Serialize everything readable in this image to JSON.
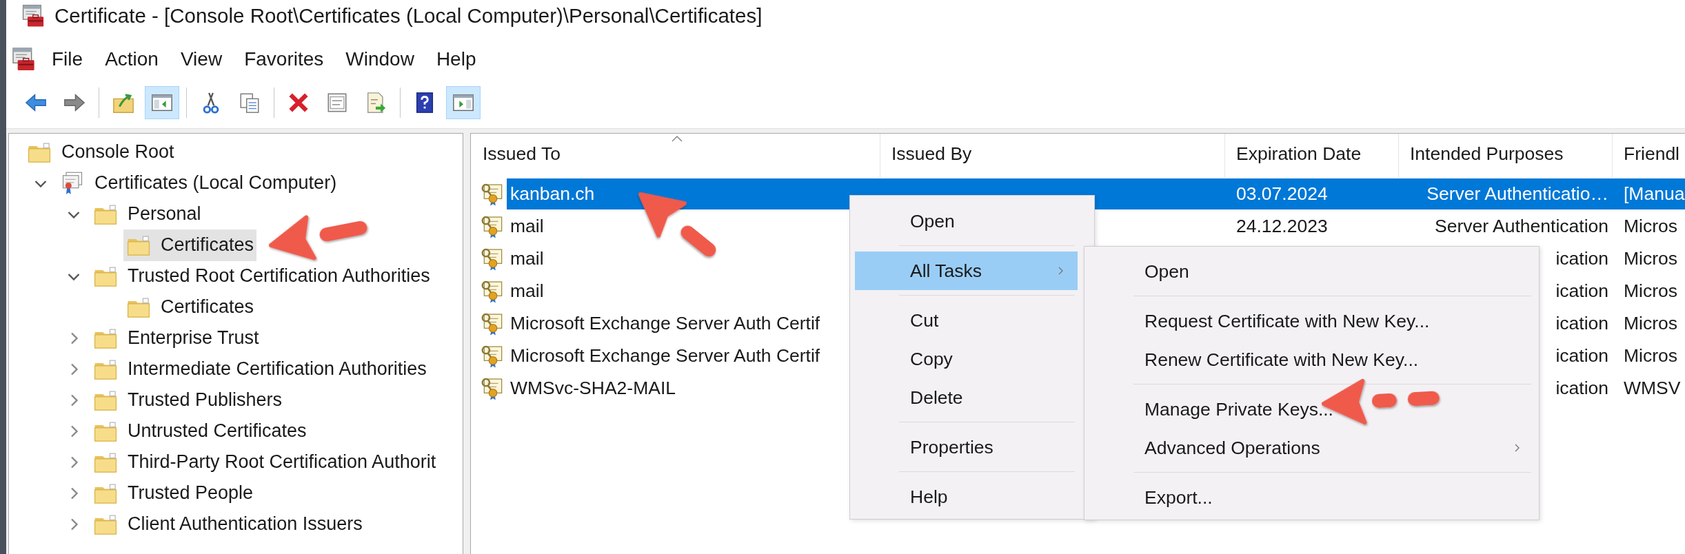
{
  "window": {
    "title": "Certificate - [Console Root\\Certificates (Local Computer)\\Personal\\Certificates]"
  },
  "menu": [
    "File",
    "Action",
    "View",
    "Favorites",
    "Window",
    "Help"
  ],
  "toolbar": [
    [
      {
        "kind": "back",
        "on": false
      },
      {
        "kind": "forward",
        "on": false
      }
    ],
    [
      {
        "kind": "up",
        "on": false
      },
      {
        "kind": "console-tree",
        "on": true
      }
    ],
    [
      {
        "kind": "cut",
        "on": false
      },
      {
        "kind": "copy",
        "on": false
      }
    ],
    [
      {
        "kind": "delete",
        "on": false
      },
      {
        "kind": "properties",
        "on": false
      },
      {
        "kind": "export",
        "on": false
      }
    ],
    [
      {
        "kind": "help",
        "on": false
      },
      {
        "kind": "action-pane",
        "on": true
      }
    ]
  ],
  "tree": [
    {
      "label": "Console Root",
      "kind": "folder",
      "selected": false,
      "children": [
        {
          "label": "Certificates (Local Computer)",
          "kind": "snapin",
          "expanded": true,
          "selected": false,
          "children": [
            {
              "label": "Personal",
              "kind": "folder",
              "expanded": true,
              "selected": false,
              "children": [
                {
                  "label": "Certificates",
                  "kind": "folder",
                  "selected": true
                }
              ]
            },
            {
              "label": "Trusted Root Certification Authorities",
              "kind": "folder",
              "expanded": true,
              "selected": false,
              "children": [
                {
                  "label": "Certificates",
                  "kind": "folder",
                  "selected": false
                }
              ]
            },
            {
              "label": "Enterprise Trust",
              "kind": "folder",
              "expanded": false,
              "selected": false
            },
            {
              "label": "Intermediate Certification Authorities",
              "kind": "folder",
              "expanded": false,
              "selected": false
            },
            {
              "label": "Trusted Publishers",
              "kind": "folder",
              "expanded": false,
              "selected": false
            },
            {
              "label": "Untrusted Certificates",
              "kind": "folder",
              "expanded": false,
              "selected": false
            },
            {
              "label": "Third-Party Root Certification Authorit",
              "kind": "folder",
              "expanded": false,
              "selected": false
            },
            {
              "label": "Trusted People",
              "kind": "folder",
              "expanded": false,
              "selected": false
            },
            {
              "label": "Client Authentication Issuers",
              "kind": "folder",
              "expanded": false,
              "selected": false
            }
          ]
        }
      ]
    }
  ],
  "list": {
    "columns": [
      {
        "label": "Issued To",
        "sorted": true
      },
      {
        "label": "Issued By",
        "sorted": false
      },
      {
        "label": "Expiration Date",
        "sorted": false
      },
      {
        "label": "Intended Purposes",
        "sorted": false
      },
      {
        "label": "Friendl",
        "sorted": false
      }
    ],
    "rows": [
      {
        "selected": true,
        "cells": [
          "kanban.ch",
          null,
          "03.07.2024",
          "Server Authenticatio…",
          "[Manua"
        ]
      },
      {
        "selected": false,
        "cells": [
          "mail",
          null,
          "24.12.2023",
          "Server Authentication",
          "Micros"
        ]
      },
      {
        "selected": false,
        "cells": [
          "mail",
          null,
          null,
          "ication",
          "Micros"
        ]
      },
      {
        "selected": false,
        "cells": [
          "mail",
          null,
          null,
          "ication",
          "Micros"
        ]
      },
      {
        "selected": false,
        "cells": [
          "Microsoft Exchange Server Auth Certif",
          null,
          null,
          "ication",
          "Micros"
        ]
      },
      {
        "selected": false,
        "cells": [
          "Microsoft Exchange Server Auth Certif",
          null,
          null,
          "ication",
          "Micros"
        ]
      },
      {
        "selected": false,
        "cells": [
          "WMSvc-SHA2-MAIL",
          null,
          null,
          "ication",
          "WMSV"
        ]
      }
    ]
  },
  "context_menu": [
    {
      "kind": "item",
      "label": "Open",
      "selected": false
    },
    {
      "kind": "separator"
    },
    {
      "kind": "submenu",
      "label": "All Tasks",
      "selected": true
    },
    {
      "kind": "separator"
    },
    {
      "kind": "item",
      "label": "Cut",
      "selected": false
    },
    {
      "kind": "item",
      "label": "Copy",
      "selected": false
    },
    {
      "kind": "item",
      "label": "Delete",
      "selected": false
    },
    {
      "kind": "separator"
    },
    {
      "kind": "item",
      "label": "Properties",
      "selected": false
    },
    {
      "kind": "separator"
    },
    {
      "kind": "item",
      "label": "Help",
      "selected": false
    }
  ],
  "submenu": [
    {
      "kind": "item",
      "label": "Open",
      "selected": false
    },
    {
      "kind": "separator"
    },
    {
      "kind": "item",
      "label": "Request Certificate with New Key...",
      "selected": false
    },
    {
      "kind": "item",
      "label": "Renew Certificate with New Key...",
      "selected": false
    },
    {
      "kind": "separator"
    },
    {
      "kind": "item",
      "label": "Manage Private Keys...",
      "selected": false
    },
    {
      "kind": "submenu",
      "label": "Advanced Operations",
      "selected": false
    },
    {
      "kind": "separator"
    },
    {
      "kind": "item",
      "label": "Export...",
      "selected": false
    }
  ],
  "annotations": [
    {
      "kind": "arrow"
    },
    {
      "kind": "arrow"
    },
    {
      "kind": "arrow"
    }
  ]
}
